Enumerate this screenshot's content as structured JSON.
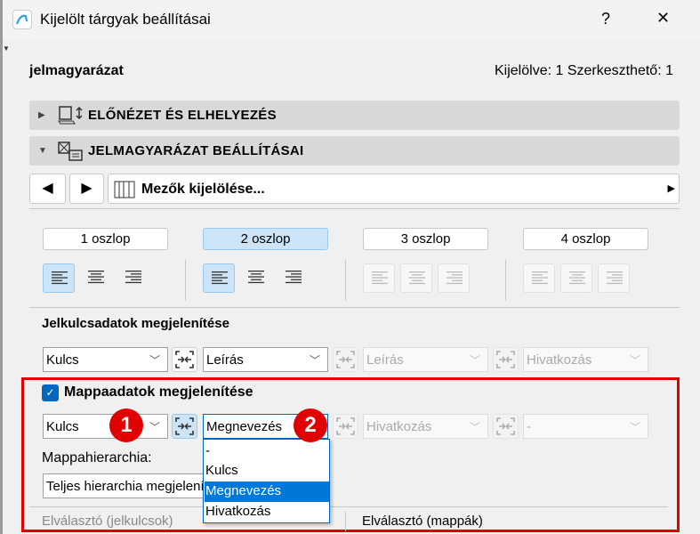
{
  "window": {
    "title": "Kijelölt tárgyak beállításai",
    "help": "?",
    "close": "✕"
  },
  "header": {
    "object": "jelmagyarázat",
    "selection_info": "Kijelölve: 1 Szerkeszthető: 1"
  },
  "sections": [
    {
      "label": "ELŐNÉZET ÉS ELHELYEZÉS",
      "expanded": false
    },
    {
      "label": "JELMAGYARÁZAT BEÁLLÍTÁSAI",
      "expanded": true
    }
  ],
  "nav": {
    "field_select": "Mezők kijelölése..."
  },
  "columns": [
    {
      "label": "1 oszlop"
    },
    {
      "label": "2 oszlop"
    },
    {
      "label": "3 oszlop"
    },
    {
      "label": "4 oszlop"
    }
  ],
  "symbol_data": {
    "title": "Jelkulcsadatok megjelenítése",
    "fields": [
      "Kulcs",
      "Leírás",
      "Leírás",
      "Hivatkozás"
    ]
  },
  "folder_data": {
    "title": "Mappaadatok megjelenítése",
    "checked": true,
    "fields": [
      "Kulcs",
      "Megnevezés",
      "Hivatkozás",
      "-"
    ],
    "hierarchy_label": "Mappahierarchia:",
    "hierarchy_value": "Teljes hierarchia megjelenítése",
    "dropdown_options": [
      "-",
      "Kulcs",
      "Megnevezés",
      "Hivatkozás"
    ],
    "selected_option": "Megnevezés"
  },
  "separators": {
    "symbols": "Elválasztó (jelkulcsok)",
    "folders": "Elválasztó (mappák)"
  },
  "badges": [
    "1",
    "2"
  ],
  "colors": {
    "accent": "#0067c0",
    "highlight": "#cce4f7",
    "annotation": "#e00000"
  }
}
